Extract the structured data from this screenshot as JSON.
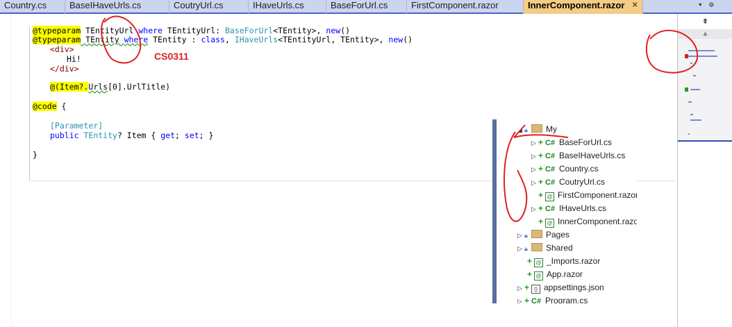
{
  "tabs": [
    {
      "label": "Country.cs",
      "active": false
    },
    {
      "label": "BaseIHaveUrls.cs",
      "active": false
    },
    {
      "label": "CoutryUrl.cs",
      "active": false
    },
    {
      "label": "IHaveUrls.cs",
      "active": false
    },
    {
      "label": "BaseForUrl.cs",
      "active": false
    },
    {
      "label": "FirstComponent.razor",
      "active": false
    },
    {
      "label": "InnerComponent.razor",
      "active": true
    }
  ],
  "tab_controls": {
    "pin": "⊸",
    "close": "×",
    "menu": "▾",
    "settings": "⚙"
  },
  "editor": {
    "lines": [
      {
        "directive": "@typeparam",
        "rest": " TEntityUrl ",
        "kw1": "where",
        "rest2": " TEntityUrl: ",
        "typ1": "BaseForUrl",
        "rest3": "<TEntity>, ",
        "kw2": "new",
        "rest4": "()"
      },
      {
        "directive": "@typeparam",
        "rest": " TEntity ",
        "kw1": "where",
        "rest2": " TEntity : ",
        "kw3": "class",
        "rest5": ", ",
        "typ1": "IHaveUrls",
        "rest3": "<TEntityUrl, TEntity>, ",
        "kw2": "new",
        "rest4": "()"
      }
    ],
    "div_open": "<div>",
    "hi": "Hi!",
    "div_close": "</div>",
    "item_expr_pre": "@(Item?.",
    "item_expr_sq": "Urls",
    "item_expr_post": "[0].UrlTitle)",
    "code_dir": "@code",
    "brace_open": " {",
    "param_attr": "[Parameter]",
    "prop_public": "public",
    "prop_type": " TEntity",
    "prop_rest": "? Item { ",
    "prop_get": "get",
    "prop_sep": "; ",
    "prop_set": "set",
    "prop_end": "; }",
    "brace_close": "}"
  },
  "annotation": "CS0311",
  "minimap": {
    "splitter": "⇟",
    "scroll_up": "▲"
  },
  "explorer": {
    "items": [
      {
        "label": "My",
        "kind": "folder",
        "expanded": true
      },
      {
        "label": "BaseForUrl.cs",
        "kind": "cs"
      },
      {
        "label": "BaseIHaveUrls.cs",
        "kind": "cs"
      },
      {
        "label": "Country.cs",
        "kind": "cs"
      },
      {
        "label": "CoutryUrl.cs",
        "kind": "cs"
      },
      {
        "label": "FirstComponent.razor",
        "kind": "razor"
      },
      {
        "label": "IHaveUrls.cs",
        "kind": "cs"
      },
      {
        "label": "InnerComponent.razor",
        "kind": "razor"
      },
      {
        "label": "Pages",
        "kind": "folder"
      },
      {
        "label": "Shared",
        "kind": "folder"
      },
      {
        "label": "_Imports.razor",
        "kind": "razor"
      },
      {
        "label": "App.razor",
        "kind": "razor"
      },
      {
        "label": "appsettings.json",
        "kind": "json"
      },
      {
        "label": "Program.cs",
        "kind": "cs"
      }
    ],
    "icons": {
      "cs": "C#",
      "razor": "@",
      "json": "{}"
    }
  },
  "colors": {
    "accent": "#f5cc84",
    "keyword": "#0000ff",
    "type": "#2b91af",
    "annotation": "#d92020"
  }
}
